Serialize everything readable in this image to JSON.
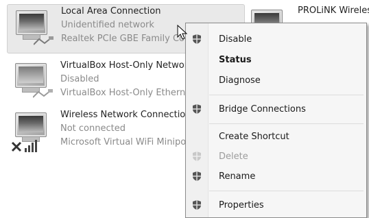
{
  "connections": [
    {
      "name": "Local Area Connection",
      "status": "Unidentified network",
      "device": "Realtek PCIe GBE Family Controller"
    },
    {
      "name": "VirtualBox Host-Only Network",
      "status": "Disabled",
      "device": "VirtualBox Host-Only Ethernet Adapter"
    },
    {
      "name": "Wireless Network Connection",
      "status": "Not connected",
      "device": "Microsoft Virtual WiFi Miniport Adapter"
    },
    {
      "name": "PROLiNK Wireless"
    }
  ],
  "context_menu": {
    "items": [
      {
        "label": "Disable",
        "icon": "shield-icon"
      },
      {
        "label": "Status"
      },
      {
        "label": "Diagnose"
      },
      {
        "label": "Bridge Connections",
        "icon": "shield-icon"
      },
      {
        "label": "Create Shortcut"
      },
      {
        "label": "Delete",
        "icon": "shield-icon"
      },
      {
        "label": "Rename",
        "icon": "shield-icon"
      },
      {
        "label": "Properties",
        "icon": "shield-icon"
      }
    ]
  }
}
